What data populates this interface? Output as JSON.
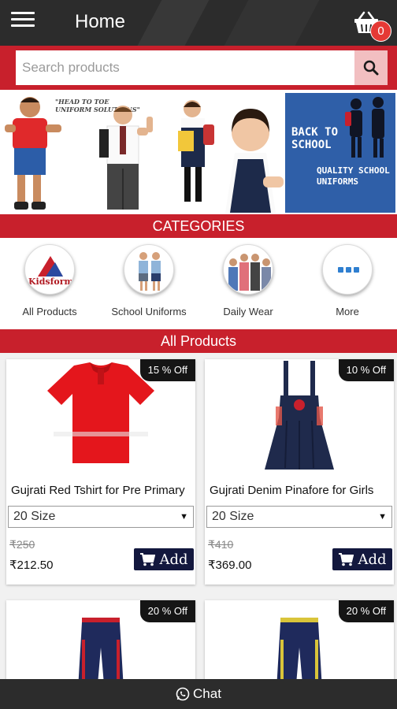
{
  "header": {
    "title": "Home",
    "cart_count": "0",
    "menu_icon": "hamburger-icon",
    "cart_icon": "basket-icon"
  },
  "search": {
    "placeholder": "Search products",
    "icon": "search-icon"
  },
  "banner": {
    "tagline": "\"HEAD TO TOE UNIFORM SOLUTIONS\"",
    "promo_title": "BACK TO SCHOOL",
    "promo_subtitle": "QUALITY SCHOOL UNIFORMS"
  },
  "categories": {
    "heading": "CATEGORIES",
    "items": [
      {
        "label": "All Products",
        "logo_text": "Kidsform"
      },
      {
        "label": "School Uniforms"
      },
      {
        "label": "Daily Wear"
      },
      {
        "label": "More"
      }
    ]
  },
  "products": {
    "heading": "All Products",
    "items": [
      {
        "name": "Gujrati Red Tshirt for Pre Primary",
        "discount": "15 % Off",
        "size": "20 Size",
        "old_price": "₹250",
        "price": "₹212.50",
        "add_label": "Add"
      },
      {
        "name": "Gujrati Denim Pinafore for Girls",
        "discount": "10 % Off",
        "size": "20 Size",
        "old_price": "₹410",
        "price": "₹369.00",
        "add_label": "Add"
      },
      {
        "discount": "20 % Off"
      },
      {
        "discount": "20 % Off"
      }
    ]
  },
  "chat": {
    "label": "Chat",
    "icon": "whatsapp-icon"
  },
  "colors": {
    "brand_red": "#c8202c",
    "topbar": "#2c2c2c",
    "add_button": "#13183e",
    "badge": "#e53935"
  }
}
